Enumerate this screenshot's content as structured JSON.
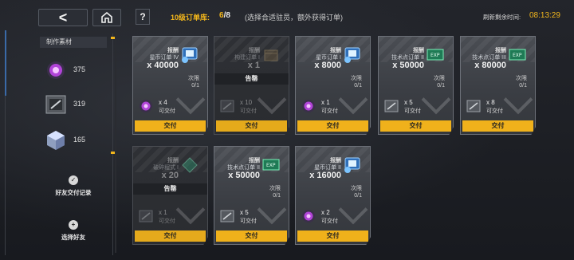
{
  "header": {
    "back_label": "<",
    "help_label": "?",
    "order_title": "10级订单库:",
    "order_count_current": "6",
    "order_count_total": "/8",
    "order_hint": "(选择合适驻员，额外获得订单)",
    "refresh_label": "刷新剩余时间:",
    "refresh_time": "08:13:29"
  },
  "sidebar": {
    "title": "制作素材",
    "materials": [
      {
        "icon": "purple-orb-icon",
        "qty": "375"
      },
      {
        "icon": "data-chip-icon",
        "qty": "319"
      },
      {
        "icon": "cube-icon",
        "qty": "165"
      }
    ],
    "friend_records": "好友交付记录",
    "select_friend": "选择好友"
  },
  "cards": [
    {
      "reward_label": "报酬",
      "order_name": "星币订单 IV",
      "reward_qty": "x 40000",
      "reward_icon": "coin-card-icon",
      "limit_label": "次限",
      "limit_val": "0/1",
      "req_qty": "x 4",
      "req_status": "可交付",
      "req_icon": "purple-orb-icon",
      "deliver": "交付",
      "sold": false
    },
    {
      "reward_label": "报酬",
      "order_name": "构建订单 I",
      "reward_qty": "x 1",
      "reward_icon": "box-icon",
      "limit_label": "",
      "limit_val": "",
      "req_qty": "x 10",
      "req_status": "可交付",
      "req_icon": "data-chip-icon",
      "deliver": "交付",
      "sold": true,
      "sold_label": "告罄"
    },
    {
      "reward_label": "报酬",
      "order_name": "星币订单 I",
      "reward_qty": "x 8000",
      "reward_icon": "coin-card-icon",
      "limit_label": "次限",
      "limit_val": "0/1",
      "req_qty": "x 1",
      "req_status": "可交付",
      "req_icon": "purple-orb-icon",
      "deliver": "交付",
      "sold": false
    },
    {
      "reward_label": "报酬",
      "order_name": "技术点订单 II",
      "reward_qty": "x 50000",
      "reward_icon": "exp-card-icon",
      "limit_label": "次限",
      "limit_val": "0/1",
      "req_qty": "x 5",
      "req_status": "可交付",
      "req_icon": "data-chip-icon",
      "deliver": "交付",
      "sold": false
    },
    {
      "reward_label": "报酬",
      "order_name": "技术点订单 III",
      "reward_qty": "x 80000",
      "reward_icon": "exp-card-icon",
      "limit_label": "次限",
      "limit_val": "0/1",
      "req_qty": "x 8",
      "req_status": "可交付",
      "req_icon": "data-chip-icon",
      "deliver": "交付",
      "sold": false
    },
    {
      "reward_label": "报酬",
      "order_name": "破碎程式 I",
      "reward_qty": "x 20",
      "reward_icon": "diamond-icon",
      "limit_label": "",
      "limit_val": "",
      "req_qty": "x 1",
      "req_status": "可交付",
      "req_icon": "data-chip-icon",
      "deliver": "交付",
      "sold": true,
      "sold_label": "告罄"
    },
    {
      "reward_label": "报酬",
      "order_name": "技术点订单 II",
      "reward_qty": "x 50000",
      "reward_icon": "exp-card-icon",
      "limit_label": "次限",
      "limit_val": "0/1",
      "req_qty": "x 5",
      "req_status": "可交付",
      "req_icon": "data-chip-icon",
      "deliver": "交付",
      "sold": false
    },
    {
      "reward_label": "报酬",
      "order_name": "星币订单 II",
      "reward_qty": "x 16000",
      "reward_icon": "coin-card-icon",
      "limit_label": "次限",
      "limit_val": "0/1",
      "req_qty": "x 2",
      "req_status": "可交付",
      "req_icon": "purple-orb-icon",
      "deliver": "交付",
      "sold": false
    }
  ],
  "colors": {
    "accent": "#f2b61c",
    "deliver_button": "#f0b11b"
  }
}
